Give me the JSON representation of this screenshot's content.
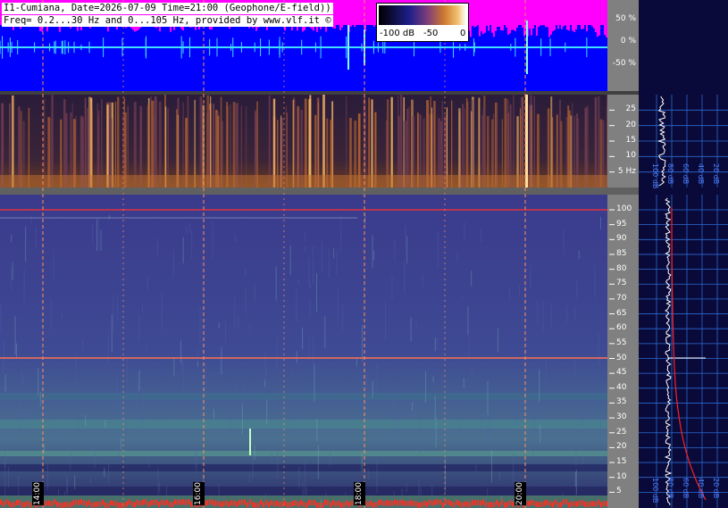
{
  "header": {
    "line1": "I1-Cumiana, Date=2026-07-09 Time=21:00 (Geophone/E-field))",
    "line2": "Freq= 0.2...30 Hz and 0...105 Hz, provided by www.vlf.it ©"
  },
  "colorbar": {
    "label_low": "-100 dB",
    "label_mid": "-50",
    "label_high": "0"
  },
  "chart_data": [
    {
      "type": "line",
      "panel": "amplitude",
      "y_ticks": [
        "50 %",
        "0 %",
        "-50 %"
      ],
      "y_values": [
        50,
        0,
        -50
      ]
    },
    {
      "type": "heatmap",
      "panel": "spectrogram 0.2-30 Hz",
      "y_ticks": [
        "25",
        "20",
        "15",
        "10",
        "5 Hz"
      ],
      "y_values": [
        25,
        20,
        15,
        10,
        5
      ],
      "side_ticks": [
        "100 dB",
        "80 dB",
        "60 dB",
        "40 dB",
        "20 dB"
      ]
    },
    {
      "type": "heatmap",
      "panel": "spectrogram 0-105 Hz",
      "y_ticks": [
        "100",
        "95",
        "90",
        "85",
        "80",
        "75",
        "70",
        "65",
        "60",
        "55",
        "50",
        "45",
        "40",
        "35",
        "30",
        "25",
        "20",
        "15",
        "10",
        "5"
      ],
      "y_values": [
        100,
        95,
        90,
        85,
        80,
        75,
        70,
        65,
        60,
        55,
        50,
        45,
        40,
        35,
        30,
        25,
        20,
        15,
        10,
        5
      ],
      "side_ticks": [
        "100 dB",
        "80 dB",
        "60 dB",
        "40 dB",
        "20 dB"
      ],
      "time_labels": [
        "14:00",
        "16:00",
        "18:00",
        "20:00"
      ],
      "time_values": [
        14,
        16,
        18,
        20
      ],
      "notable_lines_hz": [
        50,
        100
      ]
    }
  ]
}
